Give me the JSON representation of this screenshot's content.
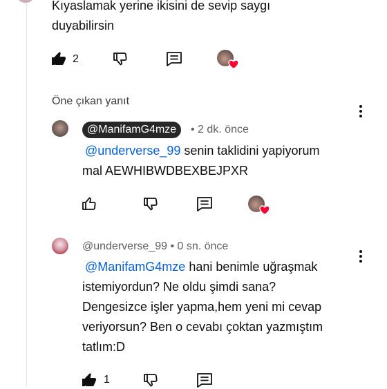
{
  "top_comment": {
    "text_line1": "Kıyaslamak yerine ikisini de sevip saygı",
    "text_line2": "duyabilirsin",
    "like_count": "2"
  },
  "featured_label": "Öne çıkan yanıt",
  "reply1": {
    "author": "@ManifamG4mze",
    "time": "• 2 dk. önce",
    "mention": "@underverse_99",
    "text_line1_rest": " senin taklidini yapiyorum",
    "text_line2": "mal AEWHIBWDBEXBEJPXR"
  },
  "reply2": {
    "author": "@underverse_99",
    "time": "• 0 sn. önce",
    "mention": "@ManifamG4mze",
    "text_line1_rest": " hani benimle uğraşmak",
    "text_line2": "istemiyordun? Ne oldu şimdi sana?",
    "text_line3": "Dengesizce işler yapma,hem yeni mi cevap",
    "text_line4": "veriyorsun? Ben o cevabı çoktan yazmıştım",
    "text_line5": "tatlım:D",
    "like_count": "1"
  },
  "icons": {
    "like": "thumbs-up-icon",
    "dislike": "thumbs-down-icon",
    "reply": "comment-icon",
    "more": "more-vert-icon",
    "creator_heart": "heart-icon"
  },
  "colors": {
    "mention": "#065fd4",
    "heart": "#ff0033",
    "badge_bg": "#272727",
    "meta": "#606060"
  }
}
